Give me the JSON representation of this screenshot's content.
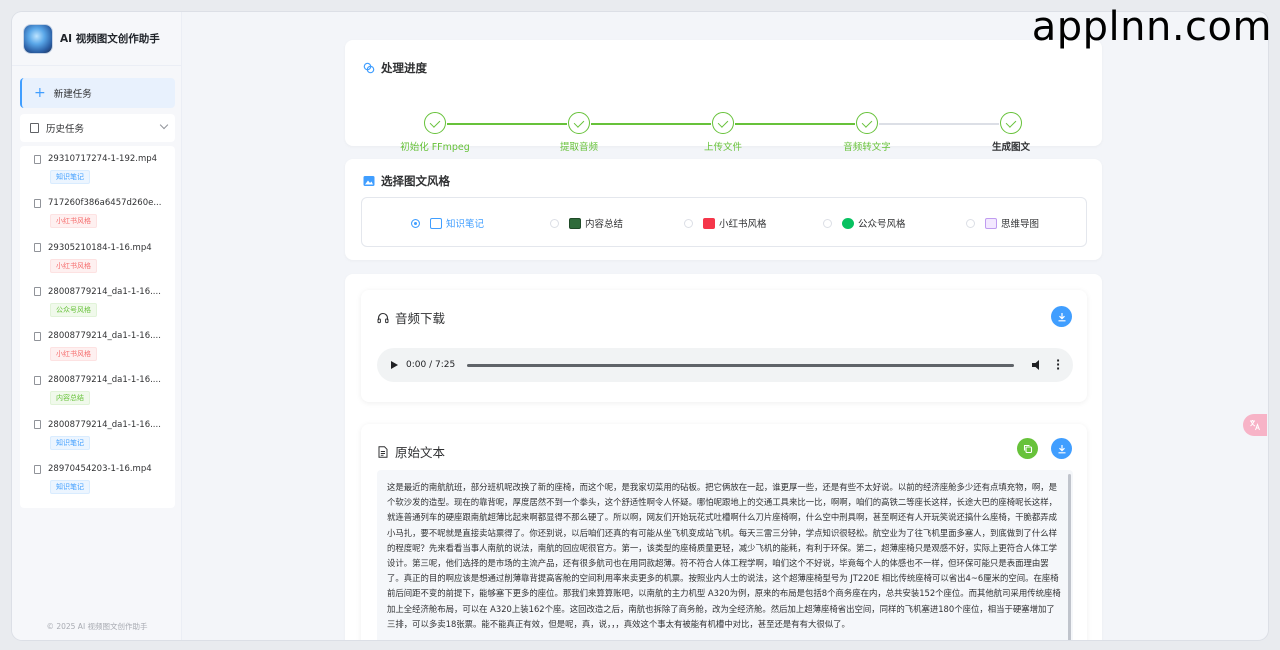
{
  "watermark": "applnn.com",
  "sidebar": {
    "app_title": "AI 视频图文创作助手",
    "new_task": "新建任务",
    "history_label": "历史任务",
    "history": [
      {
        "name": "29310717274-1-192.mp4",
        "tag": "知识笔记",
        "tag_color": "blue"
      },
      {
        "name": "717260f386a6457d260e...",
        "tag": "小红书风格",
        "tag_color": "red"
      },
      {
        "name": "29305210184-1-16.mp4",
        "tag": "小红书风格",
        "tag_color": "red"
      },
      {
        "name": "28008779214_da1-1-16....",
        "tag": "公众号风格",
        "tag_color": "green"
      },
      {
        "name": "28008779214_da1-1-16....",
        "tag": "小红书风格",
        "tag_color": "red"
      },
      {
        "name": "28008779214_da1-1-16....",
        "tag": "内容总结",
        "tag_color": "green"
      },
      {
        "name": "28008779214_da1-1-16....",
        "tag": "知识笔记",
        "tag_color": "blue"
      },
      {
        "name": "28970454203-1-16.mp4",
        "tag": "知识笔记",
        "tag_color": "blue"
      }
    ],
    "footer": "© 2025 AI 视频图文创作助手"
  },
  "progress": {
    "title": "处理进度",
    "steps": [
      "初始化 FFmpeg",
      "提取音频",
      "上传文件",
      "音频转文字",
      "生成图文"
    ],
    "done_color": "#67c23a"
  },
  "style_select": {
    "title": "选择图文风格",
    "options": [
      {
        "label": "知识笔记",
        "selected": true,
        "icon": "notebook-icon"
      },
      {
        "label": "内容总结",
        "selected": false,
        "icon": "monitor-chart-icon"
      },
      {
        "label": "小红书风格",
        "selected": false,
        "icon": "xiaohongshu-icon"
      },
      {
        "label": "公众号风格",
        "selected": false,
        "icon": "wechat-icon"
      },
      {
        "label": "思维导图",
        "selected": false,
        "icon": "mindmap-icon"
      }
    ]
  },
  "audio": {
    "title": "音频下载",
    "time": "0:00 / 7:25"
  },
  "transcript": {
    "title": "原始文本",
    "text": "这是最近的南航航班，部分班机呢改换了新的座椅，而这个呢，是我家切菜用的砧板。把它俩放在一起，谁更厚一些，还是有些不太好说。以前的经济座舱多少还有点填充物，啊，是个软沙发的造型。现在的靠背呢，厚度居然不到一个拳头，这个舒适性啊令人怀疑。哪怕呢跟地上的交通工具来比一比，啊啊，咱们的高铁二等座长这样，长途大巴的座椅呢长这样，就连普通列车的硬座跟南航超薄比起来啊都显得不那么硬了。所以啊，网友们开始玩花式吐槽啊什么刀片座椅啊，什么空中刑具啊，甚至啊还有人开玩笑说还搞什么座椅，干脆都弄成小马扎，要不呢就是直接卖站票得了。你还别说，以后咱们还真的有可能从坐飞机变成站飞机。每天三雷三分钟，学点知识很轻松。航空业为了往飞机里面多塞人，到底做到了什么样的程度呢？先来看看当事人南航的说法，南航的回应呢很官方。第一，该类型的座椅质量更轻，减少飞机的能耗，有利于环保。第二，超薄座椅只是观感不好，实际上更符合人体工学设计。第三呢，他们选择的是市场的主流产品，还有很多航司也在用同款超薄。符不符合人体工程学啊，咱们这个不好说，毕竟每个人的体感也不一样，但环保可能只是表面理由罢了。真正的目的啊应该是想通过削薄靠背提高客舱的空间利用率来卖更多的机票。按照业内人士的说法，这个超薄座椅型号为 JT220E 相比传统座椅可以省出4~6厘米的空间。在座椅前后间距不变的前提下，能够塞下更多的座位。那我们来算算账吧，以南航的主力机型 A320为例，原来的布局是包括8个商务座在内，总共安装152个座位。而其他航司采用传统座椅加上全经济舱布局，可以在 A320上装162个座。这回改造之后，南航也拆除了商务舱，改为全经济舱。然后加上超薄座椅省出空间，同样的飞机塞进180个座位，相当于硬塞增加了三排，可以多卖18张票。能不能真正有效，但是呢，真，说，，，真效这个事太有被能有机槽中对比，甚至还是有有大很似了。"
  }
}
